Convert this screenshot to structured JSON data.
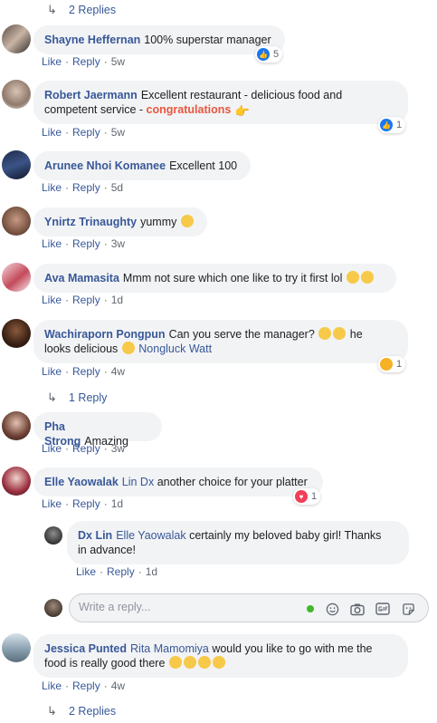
{
  "actions": {
    "like": "Like",
    "reply": "Reply",
    "sep": "·"
  },
  "top_replies": {
    "label": "2 Replies"
  },
  "comments": [
    {
      "name": "Shayne Heffernan",
      "text": "100% superstar manager",
      "time": "5w",
      "reaction_count": "5"
    },
    {
      "name": "Robert Jaermann",
      "text1": "Excellent restaurant - delicious food and",
      "text2": "competent service - ",
      "highlight": "congratulations",
      "time": "5w",
      "reaction_count": "1"
    },
    {
      "name": "Arunee Nhoi Komanee",
      "text": "Excellent 100",
      "time": "5d"
    },
    {
      "name": "Ynirtz Trinaughty",
      "text": "yummy",
      "time": "3w"
    },
    {
      "name": "Ava Mamasita",
      "text": "Mmm not sure which one like to try it first lol",
      "time": "1d"
    },
    {
      "name": "Wachiraporn Pongpun",
      "text1": "Can you serve the manager?",
      "text1b": "he",
      "text2": "looks delicious",
      "tag": "Nongluck Watt",
      "time": "4w",
      "reaction_count": "1",
      "replies": "1 Reply"
    },
    {
      "name": "Pha Strong",
      "text": "Amazing",
      "time": "3w"
    },
    {
      "name": "Elle Yaowalak",
      "tag": "Lin Dx",
      "text": "another choice for your platter",
      "time": "1d",
      "reaction_count": "1"
    },
    {
      "name": "Dx Lin",
      "tag": "Elle Yaowalak",
      "text1": "certainly my beloved baby girl! Thanks",
      "text2": "in advance!",
      "time": "1d"
    },
    {
      "name": "Jessica Punted",
      "tag": "Rita Mamomiya",
      "text1": "would you like to go with me the",
      "text2": "food is really good there",
      "time": "4w",
      "replies": "2 Replies"
    }
  ],
  "reply_box": {
    "placeholder": "Write a reply..."
  },
  "colors": {
    "link": "#385898",
    "bubble": "#f2f3f5",
    "like_blue": "#1877f2",
    "love_red": "#f33e58",
    "congrats": "#e9573e"
  }
}
